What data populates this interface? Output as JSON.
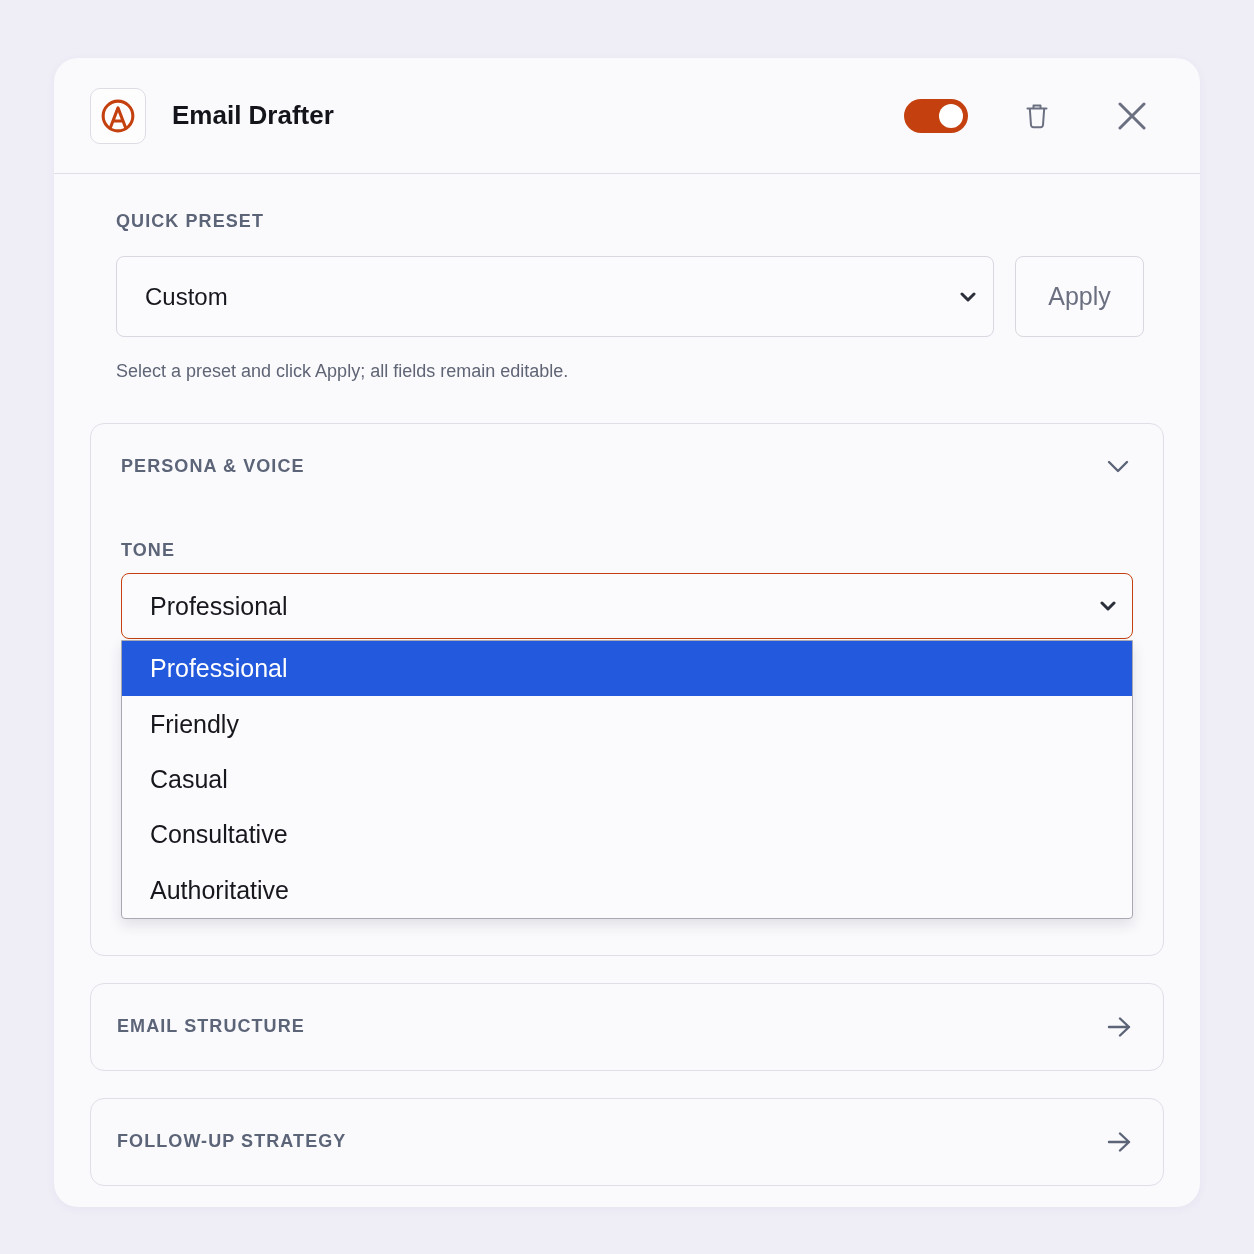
{
  "window": {
    "title": "Email Drafter",
    "enabled": true
  },
  "quick_preset": {
    "label": "QUICK PRESET",
    "value": "Custom",
    "button": "Apply",
    "hint": "Select a preset and click Apply; all fields remain editable."
  },
  "sections": [
    {
      "kind": "accordion",
      "title": "PERSONA & VOICE",
      "expanded": true,
      "fields": [
        {
          "label": "TONE",
          "value": "Professional",
          "open": true,
          "options": [
            {
              "label": "Professional",
              "selected": true
            },
            {
              "label": "Friendly",
              "selected": false
            },
            {
              "label": "Casual",
              "selected": false
            },
            {
              "label": "Consultative",
              "selected": false
            },
            {
              "label": "Authoritative",
              "selected": false
            }
          ]
        }
      ]
    },
    {
      "kind": "link",
      "title": "EMAIL STRUCTURE"
    },
    {
      "kind": "link",
      "title": "FOLLOW-UP STRATEGY"
    }
  ]
}
